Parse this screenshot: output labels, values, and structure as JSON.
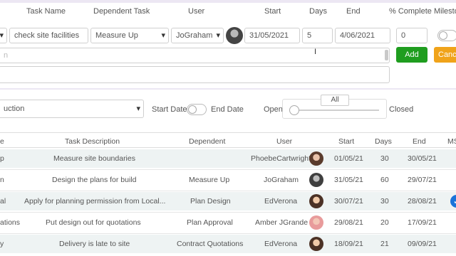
{
  "form": {
    "headers": {
      "task_name": "Task Name",
      "dependent_task": "Dependent Task",
      "user": "User",
      "start": "Start",
      "days": "Days",
      "end": "End",
      "complete": "% Complete",
      "milestone": "Milesto"
    },
    "task_name_value": "check site facilities",
    "dependent_task_value": "Measure Up",
    "user_value": "JoGraham",
    "start_value": "31/05/2021",
    "days_value": "5",
    "end_value": "4/06/2021",
    "complete_value": "0",
    "description_placeholder": "n",
    "add_label": "Add",
    "cancel_label": "Cance"
  },
  "filter": {
    "project_value": "uction",
    "start_date_label": "Start Date",
    "end_date_label": "End Date",
    "open_label": "Open",
    "closed_label": "Closed",
    "slider_label": "All",
    "slider_value": 0
  },
  "table": {
    "headers": {
      "name": "e",
      "description": "Task Description",
      "dependent": "Dependent",
      "user": "User",
      "start": "Start",
      "days": "Days",
      "end": "End",
      "ms": "MS"
    },
    "rows": [
      {
        "name": "p",
        "description": "Measure site boundaries",
        "dependent": "",
        "user": "PhoebeCartwright",
        "start": "01/05/21",
        "days": "30",
        "end": "30/05/21",
        "ms": false
      },
      {
        "name": "n",
        "description": "Design the plans for build",
        "dependent": "Measure Up",
        "user": "JoGraham",
        "start": "31/05/21",
        "days": "60",
        "end": "29/07/21",
        "ms": false
      },
      {
        "name": "al",
        "description": "Apply for planning permission from Local...",
        "dependent": "Plan Design",
        "user": "EdVerona",
        "start": "30/07/21",
        "days": "30",
        "end": "28/08/21",
        "ms": true
      },
      {
        "name": "ations",
        "description": "Put design out for quotations",
        "dependent": "Plan Approval",
        "user": "Amber JGrande",
        "start": "29/08/21",
        "days": "20",
        "end": "17/09/21",
        "ms": false
      },
      {
        "name": "y",
        "description": "Delivery is late to site",
        "dependent": "Contract Quotations",
        "user": "EdVerona",
        "start": "18/09/21",
        "days": "21",
        "end": "09/09/21",
        "ms": false
      }
    ]
  },
  "colors": {
    "add": "#1f9d1f",
    "cancel": "#f0a31a",
    "check": "#1a73d9",
    "alt_row": "#eef3f3"
  }
}
